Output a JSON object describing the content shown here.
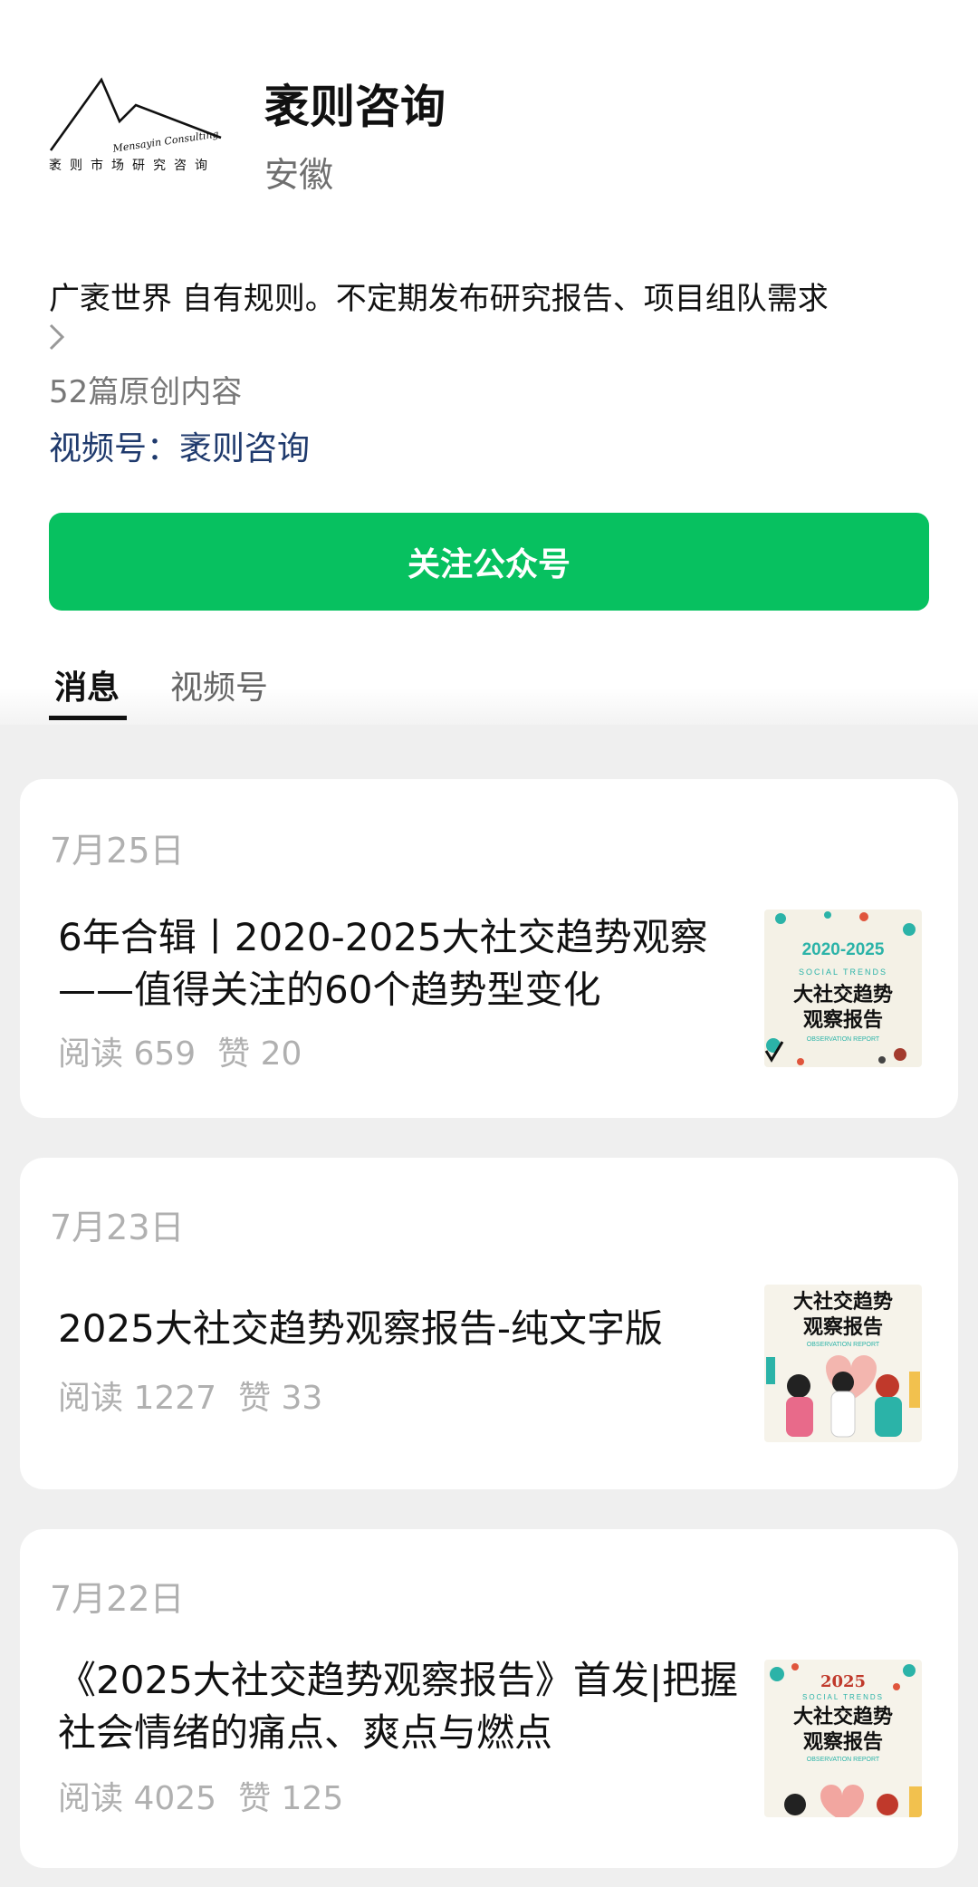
{
  "account": {
    "logo_script": "Mensayin Consulting",
    "logo_cn": "袤则市场研究咨询",
    "name": "袤则咨询",
    "region": "安徽",
    "intro": "广袤世界 自有规则。不定期发布研究报告、项目组队需求",
    "original_count": "52篇原创内容",
    "channels_link": "视频号：袤则咨询",
    "follow_label": "关注公众号"
  },
  "tabs": [
    {
      "label": "消息",
      "active": true
    },
    {
      "label": "视频号",
      "active": false
    }
  ],
  "posts": [
    {
      "date": "7月25日",
      "title": "6年合辑丨2020-2025大社交趋势观察——值得关注的60个趋势型变化",
      "reads": "阅读 659",
      "likes": "赞 20",
      "thumb": {
        "year": "2020-2025",
        "subtitle": "SOCIAL TRENDS",
        "title_line1": "大社交趋势",
        "title_line2": "观察报告",
        "footer": "OBSERVATION REPORT"
      }
    },
    {
      "date": "7月23日",
      "title": "2025大社交趋势观察报告-纯文字版",
      "reads": "阅读 1227",
      "likes": "赞 33",
      "thumb": {
        "title_line1": "大社交趋势",
        "title_line2": "观察报告",
        "footer": "OBSERVATION REPORT"
      }
    },
    {
      "date": "7月22日",
      "title": "《2025大社交趋势观察报告》首发|把握社会情绪的痛点、爽点与燃点",
      "reads": "阅读 4025",
      "likes": "赞 125",
      "thumb": {
        "year": "2025",
        "subtitle": "SOCIAL TRENDS",
        "title_line1": "大社交趋势",
        "title_line2": "观察报告",
        "footer": "OBSERVATION REPORT"
      }
    }
  ],
  "colors": {
    "accent": "#07c160",
    "link": "#1f3a6d",
    "muted": "#b0b0b0",
    "feed_bg": "#efefef"
  }
}
